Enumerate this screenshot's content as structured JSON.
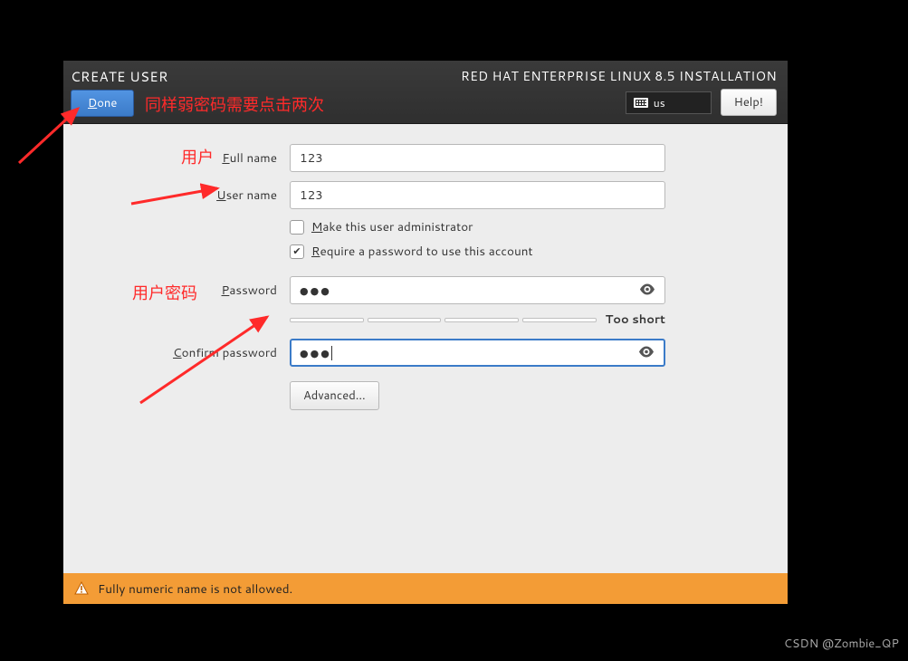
{
  "header": {
    "title": "CREATE USER",
    "done_label": "Done",
    "install_title": "RED HAT ENTERPRISE LINUX 8.5 INSTALLATION",
    "locale": "us",
    "help_label": "Help!"
  },
  "form": {
    "full_name_label": "Full name",
    "full_name_value": "123",
    "user_name_label": "User name",
    "user_name_value": "123",
    "admin_label": "Make this user administrator",
    "admin_checked": false,
    "require_pw_label": "Require a password to use this account",
    "require_pw_checked": true,
    "password_label": "Password",
    "password_value": "●●●",
    "confirm_label": "Confirm password",
    "confirm_value": "●●●",
    "strength_text": "Too short",
    "advanced_label": "Advanced..."
  },
  "warning": {
    "text": "Fully numeric name is not allowed."
  },
  "annotations": {
    "done_note": "同样弱密码需要点击两次",
    "user_note": "用户",
    "pw_note": "用户密码"
  },
  "watermark": "CSDN @Zombie_QP"
}
